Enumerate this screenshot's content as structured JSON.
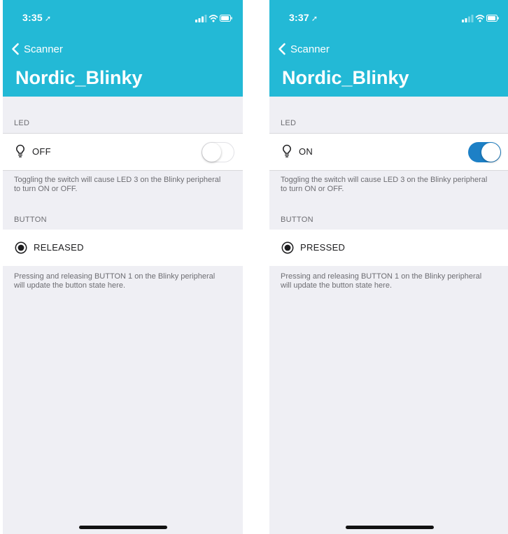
{
  "theme": {
    "accent": "#23b9d6",
    "switch_on_color": "#1d80c6"
  },
  "screens": [
    {
      "status_bar": {
        "time": "3:35",
        "location_icon": "location-arrow-icon"
      },
      "nav": {
        "back_label": "Scanner",
        "title": "Nordic_Blinky"
      },
      "led_section": {
        "header": "LED",
        "state_label": "OFF",
        "switch_on": false,
        "footer": "Toggling the switch will cause LED 3 on the Blinky peripheral to turn ON or OFF."
      },
      "button_section": {
        "header": "BUTTON",
        "state_label": "RELEASED",
        "footer": "Pressing and releasing BUTTON 1 on the Blinky peripheral will update the button state here."
      }
    },
    {
      "status_bar": {
        "time": "3:37",
        "location_icon": "location-arrow-icon"
      },
      "nav": {
        "back_label": "Scanner",
        "title": "Nordic_Blinky"
      },
      "led_section": {
        "header": "LED",
        "state_label": "ON",
        "switch_on": true,
        "footer": "Toggling the switch will cause LED 3 on the Blinky peripheral to turn ON or OFF."
      },
      "button_section": {
        "header": "BUTTON",
        "state_label": "PRESSED",
        "footer": "Pressing and releasing BUTTON 1 on the Blinky peripheral will update the button state here."
      }
    }
  ]
}
